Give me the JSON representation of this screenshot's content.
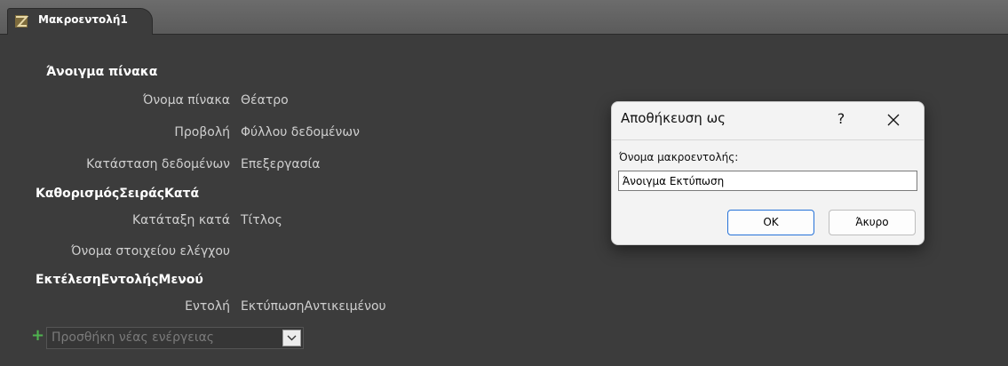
{
  "tab": {
    "title": "Μακροεντολή1",
    "icon": "macro-icon"
  },
  "actions": [
    {
      "title": "Άνοιγμα πίνακα",
      "args": [
        {
          "label": "Όνομα πίνακα",
          "value": "Θέατρο"
        },
        {
          "label": "Προβολή",
          "value": "Φύλλου δεδομένων"
        },
        {
          "label": "Κατάσταση δεδομένων",
          "value": "Επεξεργασία"
        }
      ]
    },
    {
      "title": "ΚαθορισμόςΣειράςΚατά",
      "args": [
        {
          "label": "Κατάταξη κατά",
          "value": "Τίτλος"
        },
        {
          "label": "Όνομα στοιχείου ελέγχου",
          "value": ""
        }
      ]
    },
    {
      "title": "ΕκτέλεσηΕντολήςΜενού",
      "args": [
        {
          "label": "Εντολή",
          "value": "ΕκτύπωσηΑντικειμένου"
        }
      ]
    }
  ],
  "add_action": {
    "placeholder": "Προσθήκη νέας ενέργειας",
    "plus": "+"
  },
  "dialog": {
    "title": "Αποθήκευση ως",
    "help": "?",
    "field_label": "Όνομα μακροεντολής:",
    "field_value": "Άνοιγμα Εκτύπωση",
    "ok_label": "OK",
    "cancel_label": "Άκυρο"
  },
  "colors": {
    "ok_border": "#2672d8",
    "add_plus": "#4fb34f",
    "background": "#3c3c3c"
  }
}
